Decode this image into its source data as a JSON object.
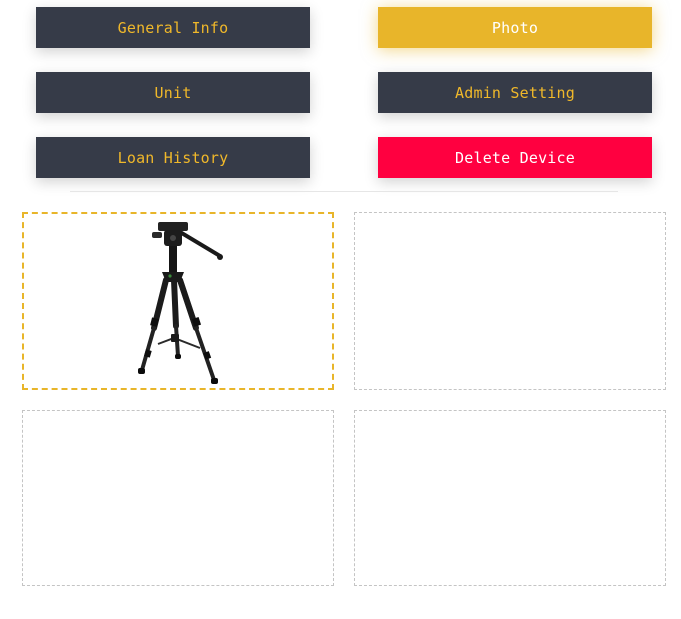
{
  "buttons": {
    "general_info": "General Info",
    "photo": "Photo",
    "unit": "Unit",
    "admin_setting": "Admin Setting",
    "loan_history": "Loan History",
    "delete_device": "Delete Device"
  },
  "photos": {
    "slots": [
      {
        "image": "tripod-photo",
        "selected": true
      },
      {
        "image": null,
        "selected": false
      },
      {
        "image": null,
        "selected": false
      },
      {
        "image": null,
        "selected": false
      }
    ]
  },
  "colors": {
    "dark_button": "#363b48",
    "accent_gold": "#e8b52a",
    "danger_red": "#ff0040"
  }
}
